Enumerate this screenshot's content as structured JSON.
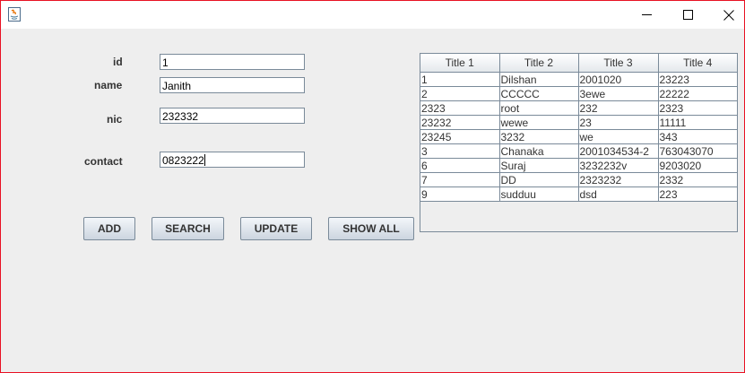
{
  "window": {
    "minimize_icon": "minimize-icon",
    "maximize_icon": "maximize-icon",
    "close_icon": "close-icon",
    "border_color": "#e81123"
  },
  "form": {
    "id_label": "id",
    "id_value": "1",
    "name_label": "name",
    "name_value": "Janith",
    "nic_label": "nic",
    "nic_value": "232332",
    "contact_label": "contact",
    "contact_value": "0823222"
  },
  "buttons": {
    "add": "ADD",
    "search": "SEARCH",
    "update": "UPDATE",
    "show_all": "SHOW ALL"
  },
  "table": {
    "columns": [
      "Title 1",
      "Title 2",
      "Title 3",
      "Title 4"
    ],
    "rows": [
      [
        "1",
        "Dilshan",
        "2001020",
        "23223"
      ],
      [
        "2",
        "CCCCC",
        "3ewe",
        "22222"
      ],
      [
        "2323",
        "root",
        "232",
        "2323"
      ],
      [
        "23232",
        "wewe",
        "23",
        "11111"
      ],
      [
        "23245",
        "3232",
        "we",
        "343"
      ],
      [
        "3",
        "Chanaka",
        "2001034534-2",
        "763043070"
      ],
      [
        "6",
        "Suraj",
        "3232232v",
        "9203020"
      ],
      [
        "7",
        "DD",
        "2323232",
        "2332"
      ],
      [
        "9",
        "sudduu",
        "dsd",
        "223"
      ]
    ]
  }
}
